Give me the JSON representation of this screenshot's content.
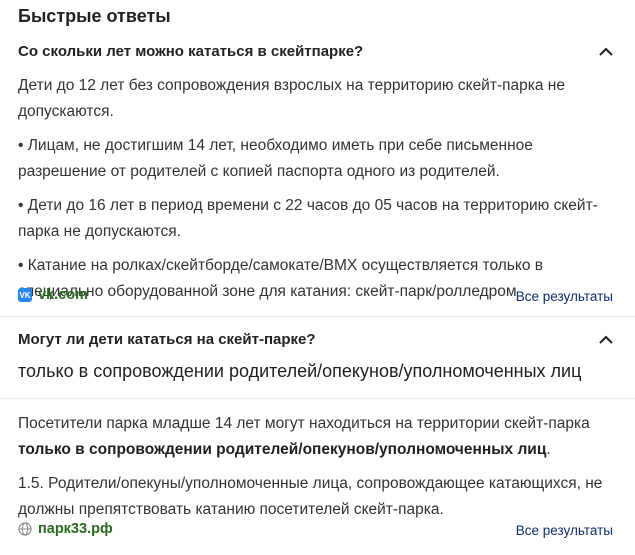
{
  "header": {
    "title": "Быстрые ответы"
  },
  "qa1": {
    "question": "Со скольки лет можно кататься в скейтпарке?",
    "paragraphs": [
      "Дети до 12 лет без сопровождения взрослых на территорию скейт-парка не допускаются.",
      "• Лицам, не достигшим 14 лет, необходимо иметь при себе письменное разрешение от родителей с копией паспорта одного из родителей.",
      "• Дети до 16 лет в период времени с 22 часов до 05 часов на территорию скейт-парка не допускаются.",
      "• Катание на ролках/скейтборде/самокате/BMX осуществляется только в специально оборудованной зоне для катания: скейт-парк/ролледром"
    ],
    "source": "vk.com",
    "all_results": "Все результаты",
    "icon": "chevron-up-icon"
  },
  "qa2": {
    "question": "Могут ли дети кататься на скейт-парке?",
    "answer": "только в сопровождении родителей/опекунов/уполномоченных лиц",
    "p1_before": "Посетители парка младше 14 лет могут находиться на территории скейт-парка ",
    "p1_bold": "только в сопровождении родителей/опекунов/уполномоченных лиц",
    "p1_after": ".",
    "p2": "1.5. Родители/опекуны/уполномоченные лица, сопровождающее катающихся, не должны препятствовать катанию посетителей скейт-парка.",
    "source": "парк33.рф",
    "all_results": "Все результаты",
    "icon": "chevron-up-icon"
  },
  "colors": {
    "source_green": "#2b6b21",
    "link_blue": "#0d2e6e",
    "vk_blue": "#2787f5"
  }
}
